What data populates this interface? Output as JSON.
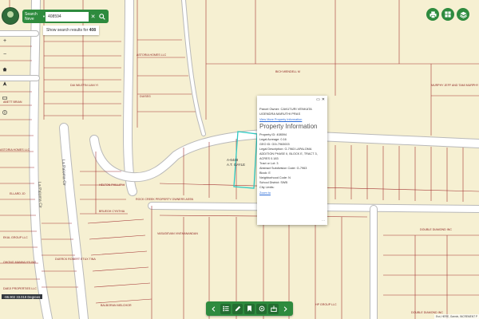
{
  "search": {
    "select_label": "Search Neve",
    "value": "408594",
    "hint_prefix": "Show search results for ",
    "hint_bold": "408"
  },
  "popup": {
    "owner": "Parcel Owner: CAVUTURI VENKATA UGENDRA MARUTHI PRAS",
    "view_more": "View More Property Information",
    "title": "Property Information",
    "fields": [
      {
        "label": "Property ID:",
        "value": "408594"
      },
      {
        "label": "Legal Acreage:",
        "value": "0.16"
      },
      {
        "label": "GEO ID:",
        "value": "G0I-7963003"
      },
      {
        "label": "Legal Description:",
        "value": "G-7963 LAPALOMA ADDITION PHASE II, BLOCK E, TRACT 3, ACRES 0.183"
      },
      {
        "label": "Tract or Lot:",
        "value": "3"
      },
      {
        "label": "Abstract Subdivision Code:",
        "value": "G-7963"
      },
      {
        "label": "Block:",
        "value": "E"
      },
      {
        "label": "Neighborhood Code:",
        "value": "N"
      },
      {
        "label": "School District:",
        "value": "SWB"
      },
      {
        "label": "City Limits:",
        "value": ""
      }
    ],
    "zoom_to": "Zoom to",
    "more": "···"
  },
  "map": {
    "colors": {
      "background": "#f6f0d2",
      "parcel_line": "#a43535",
      "highlight": "#2fc9c2",
      "road": "#ffffff",
      "road_edge": "#b9b9b9"
    },
    "streets": [
      "La Paloma Cir",
      "La Paloma Cir"
    ],
    "highlight_label": [
      "A-6448",
      "A.T. GAYLE"
    ],
    "parcel_labels": [
      "ASTORIA HOMES LLC",
      "BICH WENDELL M",
      "MURPHY JEFF AND TAMI MURPHY",
      "DAI WILEFIN LIAN YI",
      "DUISEG",
      "ABETT BRIAN",
      "ASTORIA HOMES LLC",
      "ELLARD JO",
      "HELTON PHILLIP H",
      "BRUEGH CYNTHIA",
      "ROCK CREEK PROPERTY OWNERS ASSN",
      "VASUDEVAN VIVEKANANDAN",
      "EKAL GROUP LLC",
      "OHONG MANHA HYUNG",
      "DUERCK ROBERT ETUX TINA",
      "DAEJI PROPERTIES LLC",
      "BALBORAN MELCHOR",
      "DOUBLE DIAMOND INC",
      "HP GROUP LLC",
      "DOUBLE DIAMOND INC"
    ]
  },
  "coords": "-96.902 33.019 Degrees",
  "attribution": "Esri, HERE, Garmin, INCREMENT P"
}
